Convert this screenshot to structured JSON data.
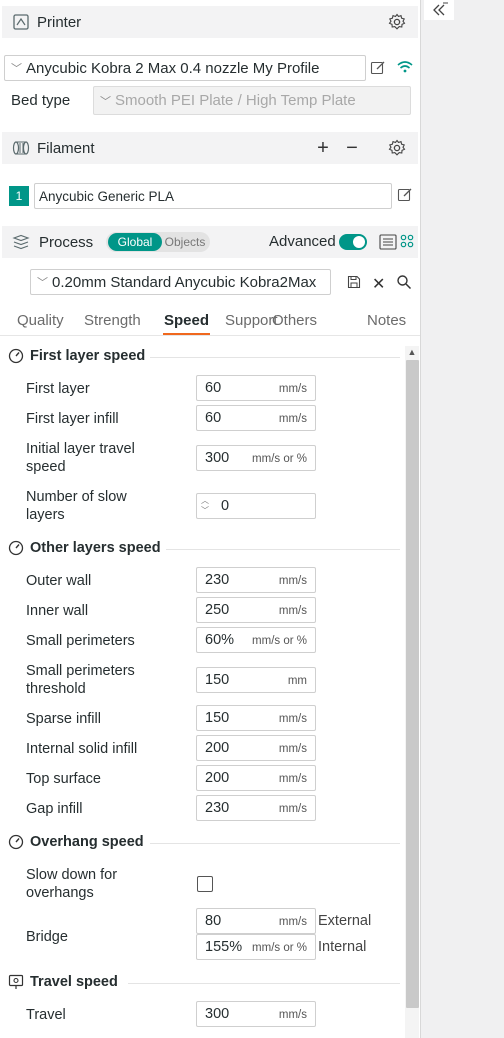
{
  "printer": {
    "title": "Printer",
    "profile": "Anycubic Kobra 2 Max 0.4 nozzle My Profile",
    "bed_type_label": "Bed type",
    "bed_type_value": "Smooth PEI Plate / High Temp Plate"
  },
  "filament": {
    "title": "Filament",
    "slot_number": "1",
    "name": "Anycubic Generic PLA",
    "slot_color": "#009688"
  },
  "process": {
    "title": "Process",
    "toggle_global": "Global",
    "toggle_objects": "Objects",
    "advanced_label": "Advanced",
    "advanced_on": true,
    "preset": "0.20mm Standard Anycubic Kobra2Max"
  },
  "tabs": [
    "Quality",
    "Strength",
    "Speed",
    "Support",
    "Others",
    "Notes"
  ],
  "active_tab": "Speed",
  "groups": {
    "first_layer": {
      "title": "First layer speed",
      "first_layer": {
        "label": "First layer",
        "value": "60",
        "unit": "mm/s"
      },
      "first_layer_infill": {
        "label": "First layer infill",
        "value": "60",
        "unit": "mm/s"
      },
      "initial_travel": {
        "label": "Initial layer travel speed",
        "value": "300",
        "unit": "mm/s or %"
      },
      "slow_layers": {
        "label": "Number of slow layers",
        "value": "0"
      }
    },
    "other_layers": {
      "title": "Other layers speed",
      "outer_wall": {
        "label": "Outer wall",
        "value": "230",
        "unit": "mm/s"
      },
      "inner_wall": {
        "label": "Inner wall",
        "value": "250",
        "unit": "mm/s"
      },
      "small_perimeters": {
        "label": "Small perimeters",
        "value": "60%",
        "unit": "mm/s or %"
      },
      "small_perimeters_threshold": {
        "label": "Small perimeters threshold",
        "value": "150",
        "unit": "mm"
      },
      "sparse_infill": {
        "label": "Sparse infill",
        "value": "150",
        "unit": "mm/s"
      },
      "internal_solid_infill": {
        "label": "Internal solid infill",
        "value": "200",
        "unit": "mm/s"
      },
      "top_surface": {
        "label": "Top surface",
        "value": "200",
        "unit": "mm/s"
      },
      "gap_infill": {
        "label": "Gap infill",
        "value": "230",
        "unit": "mm/s"
      }
    },
    "overhang": {
      "title": "Overhang speed",
      "slow_down": {
        "label": "Slow down for overhangs",
        "checked": false
      },
      "bridge": {
        "label": "Bridge",
        "external_value": "80",
        "external_unit": "mm/s",
        "external_label": "External",
        "internal_value": "155%",
        "internal_unit": "mm/s or %",
        "internal_label": "Internal"
      }
    },
    "travel": {
      "title": "Travel speed",
      "travel": {
        "label": "Travel",
        "value": "300",
        "unit": "mm/s"
      }
    }
  },
  "colors": {
    "accent": "#009688",
    "tab_underline": "#f0681d"
  },
  "icons": [
    "printer-icon",
    "gear-icon",
    "edit-icon",
    "wifi-icon",
    "filament-icon",
    "plus-icon",
    "minus-icon",
    "process-icon",
    "list-icon",
    "grid-icon",
    "save-icon",
    "close-icon",
    "search-icon",
    "speedometer-icon",
    "travel-icon",
    "collapse-icon"
  ]
}
